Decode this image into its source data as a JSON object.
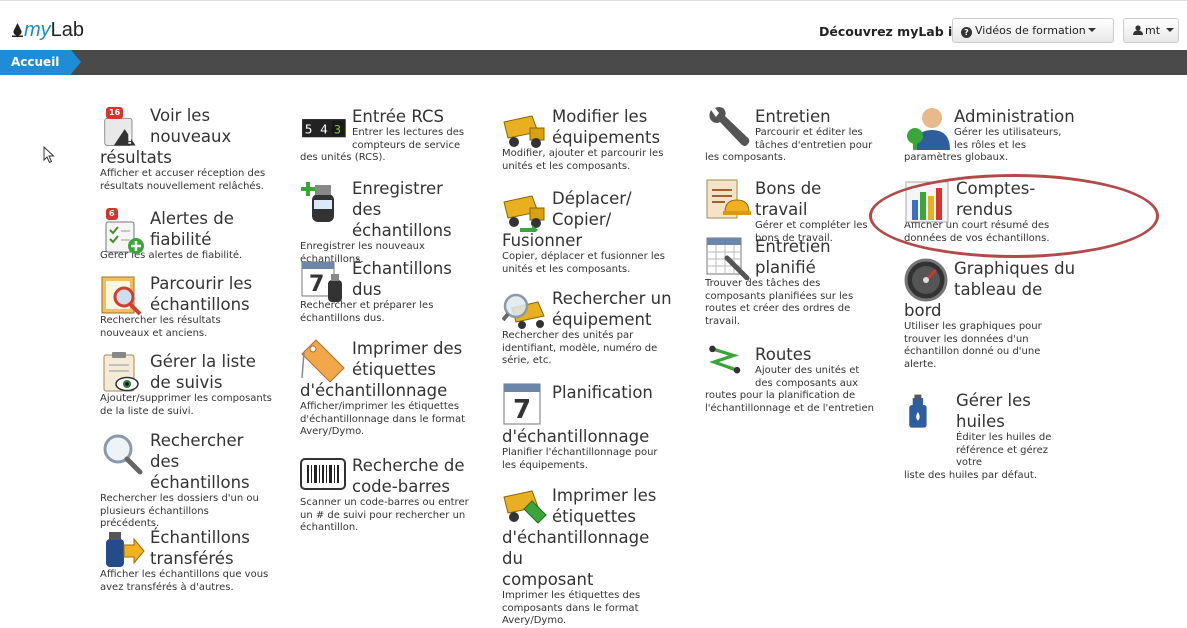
{
  "header": {
    "logo_prefix": "my",
    "logo_suffix": "Lab",
    "discover": "Découvrez myLab ici",
    "discover_arrow": "➜",
    "videos_button": "Vidéos de formation",
    "user_button": "mt"
  },
  "breadcrumb": {
    "current": "Accueil"
  },
  "badges": {
    "new_results": "16",
    "alerts": "6"
  },
  "tiles": {
    "voir": {
      "t1": "Voir les",
      "t2": "nouveaux",
      "t3": "résultats",
      "d": "Afficher et accuser réception des résultats nouvellement relâchés."
    },
    "alertes": {
      "t1": "Alertes de",
      "t2": "fiabilité",
      "d": "Gérer les alertes de fiabilité."
    },
    "parcourir": {
      "t1": "Parcourir les",
      "t2": "échantillons",
      "d": "Rechercher les résultats nouveaux et anciens."
    },
    "suivis": {
      "t1": "Gérer la liste",
      "t2": "de suivis",
      "d": "Ajouter/supprimer les composants de la liste de suivi."
    },
    "rechercher_ech": {
      "t1": "Rechercher des",
      "t2": "échantillons",
      "d": "Rechercher les dossiers d'un ou plusieurs échantillons précédents."
    },
    "transferes": {
      "t1": "Échantillons",
      "t2": "transférés",
      "d": "Afficher les échantillons que vous avez transférés à d'autres."
    },
    "rcs": {
      "t1": "Entrée RCS",
      "d1": "Entrer les lectures des",
      "d2": "compteurs de service",
      "d3": "des unités (RCS)."
    },
    "enregistrer": {
      "t1": "Enregistrer des",
      "t2": "échantillons",
      "d": "Enregistrer les nouveaux échantillons."
    },
    "dus": {
      "t1": "Échantillons",
      "t2": "dus",
      "d": "Rechercher et préparer les échantillons dus."
    },
    "imprimer_etiq": {
      "t1": "Imprimer des",
      "t2": "étiquettes",
      "t3": "d'échantillonnage",
      "d": "Afficher/imprimer les étiquettes d'échantillonnage dans le format Avery/Dymo."
    },
    "codebarres": {
      "t1": "Recherche de",
      "t2": "code-barres",
      "d": "Scanner un code-barres ou entrer un # de suivi pour rechercher un échantillon."
    },
    "modifier": {
      "t1": "Modifier les",
      "t2": "équipements",
      "d": "Modifier, ajouter et parcourir les unités et les composants."
    },
    "deplacer": {
      "t1": "Déplacer/",
      "t2": "Copier/",
      "t3": "Fusionner",
      "d": "Copier, déplacer et fusionner les unités et les composants."
    },
    "rech_equip": {
      "t1": "Rechercher un",
      "t2": "équipement",
      "d": "Rechercher des unités par identifiant, modèle, numéro de série, etc."
    },
    "planif": {
      "t1": "Planification",
      "t2": "d'échantillonnage",
      "d": "Planifier l'échantillonnage pour les équipements."
    },
    "imprimer_comp": {
      "t1": "Imprimer les",
      "t2": "étiquettes",
      "t3": "d'échantillonnage du",
      "t4": "composant",
      "d": "Imprimer les étiquettes des composants dans le format Avery/Dymo."
    },
    "entretien": {
      "t1": "Entretien",
      "d1": "Parcourir et éditer les",
      "d2": "tâches d'entretien pour",
      "d3": "les composants."
    },
    "bons": {
      "t1": "Bons de travail",
      "d1": "Gérer et compléter les",
      "d2": "bons de travail."
    },
    "entretien_pl": {
      "t1": "Entretien",
      "t2": "planifié",
      "d": "Trouver des tâches des composants planifiées sur les routes et créer des ordres de travail."
    },
    "routes": {
      "t1": "Routes",
      "d1": "Ajouter des unités et",
      "d2": "des composants aux",
      "d3": "routes pour la planification de l'échantillonnage et de l'entretien"
    },
    "admin": {
      "t1": "Administration",
      "d1": "Gérer les utilisateurs,",
      "d2": "les rôles et les",
      "d3": "paramètres globaux."
    },
    "comptes": {
      "t1": "Comptes-",
      "t2": "rendus",
      "d": "Afficher un court résumé des données de vos échantillons."
    },
    "graph": {
      "t1": "Graphiques du",
      "t2": "tableau de",
      "t3": "bord",
      "d": "Utiliser les graphiques pour trouver les données d'un échantillon donné ou d'une alerte."
    },
    "huiles": {
      "t1": "Gérer les huiles",
      "d1": "Éditer les huiles de",
      "d2": "référence et gérez votre",
      "d3": "liste des huiles par défaut."
    }
  }
}
